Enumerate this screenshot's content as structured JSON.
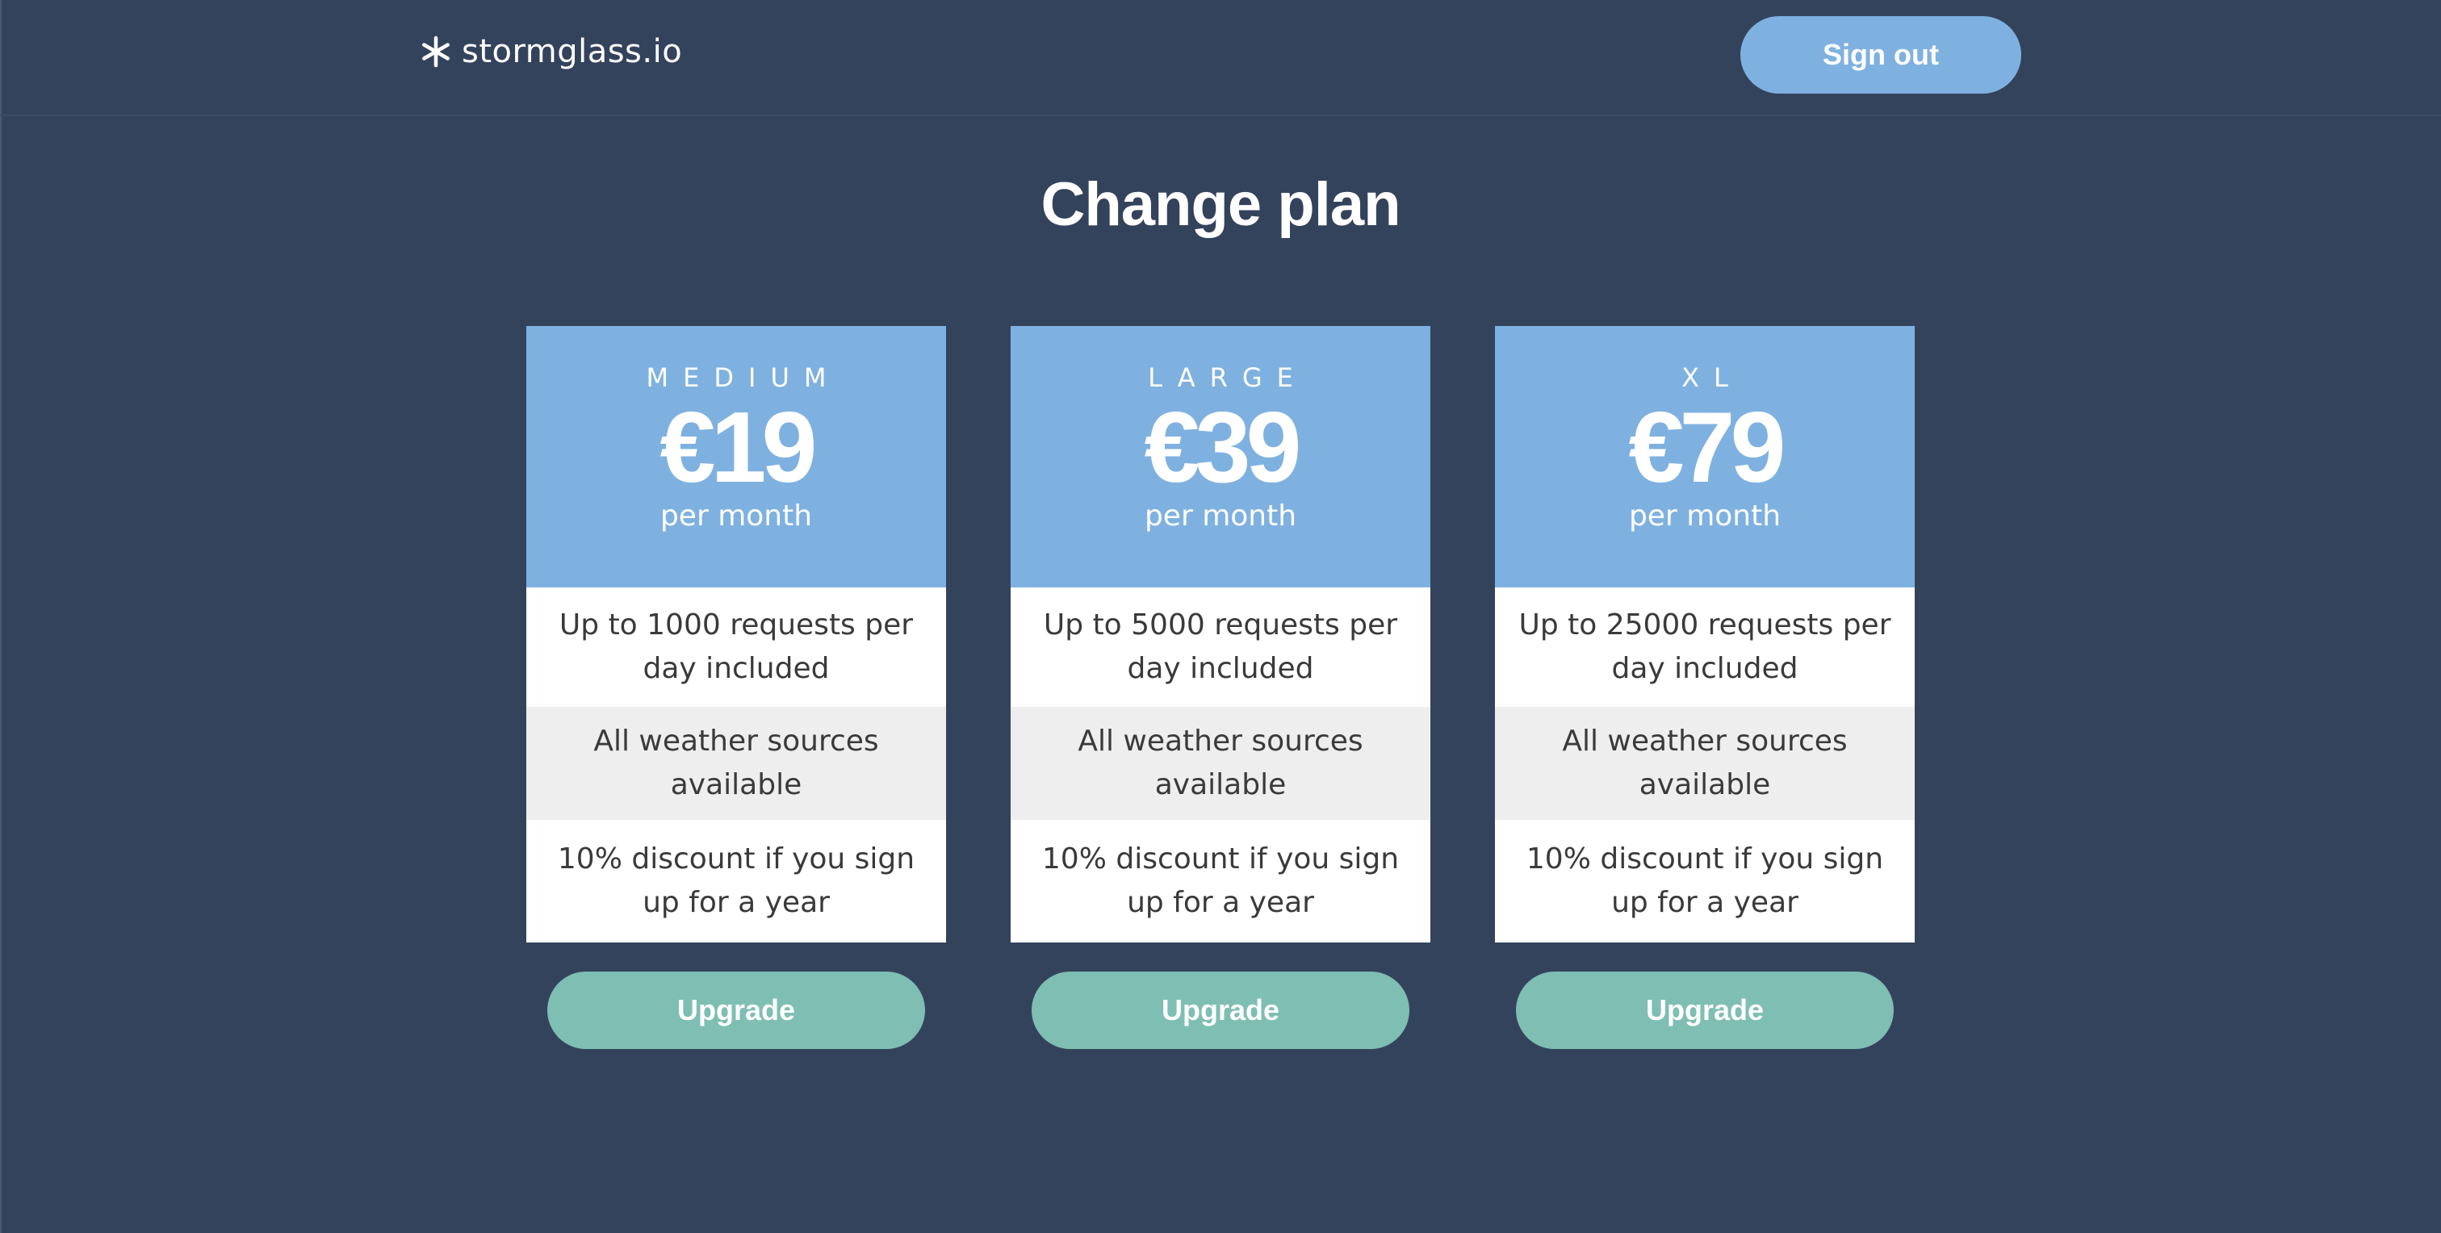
{
  "header": {
    "logo_text": "stormglass.io",
    "logo_icon": "asterisk-icon",
    "signout_label": "Sign out"
  },
  "main": {
    "title": "Change plan"
  },
  "plans": [
    {
      "name": "MEDIUM",
      "price": "€19",
      "period": "per month",
      "features": [
        "Up to 1000 requests per day included",
        "All weather sources available",
        "10% discount if you sign up for a year"
      ],
      "button_label": "Upgrade"
    },
    {
      "name": "LARGE",
      "price": "€39",
      "period": "per month",
      "features": [
        "Up to 5000 requests per day included",
        "All weather sources available",
        "10% discount if you sign up for a year"
      ],
      "button_label": "Upgrade"
    },
    {
      "name": "XL",
      "price": "€79",
      "period": "per month",
      "features": [
        "Up to 25000 requests per day included",
        "All weather sources available",
        "10% discount if you sign up for a year"
      ],
      "button_label": "Upgrade"
    }
  ],
  "colors": {
    "background": "#34435c",
    "plan_header": "#7fb1e0",
    "signout_button": "#7fb1e0",
    "upgrade_button": "#7fbeb3",
    "feature_alt_row": "#eeeeee"
  }
}
